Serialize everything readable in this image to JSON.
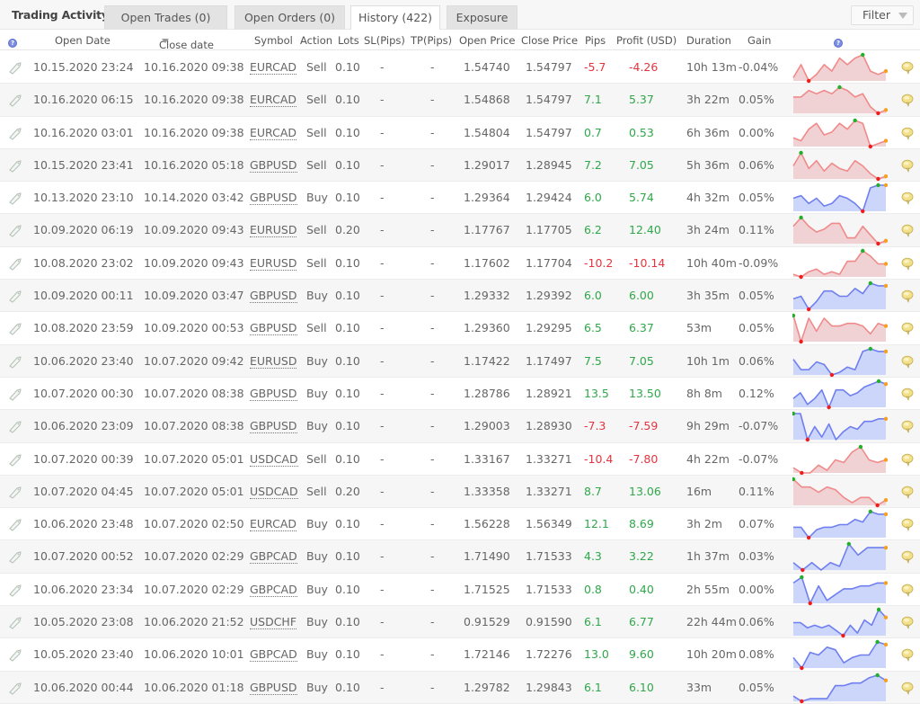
{
  "header": {
    "title": "Trading Activity",
    "tabs": [
      {
        "label": "Open Trades (0)",
        "active": false
      },
      {
        "label": "Open Orders (0)",
        "active": false
      },
      {
        "label": "History (422)",
        "active": true
      },
      {
        "label": "Exposure",
        "active": false
      }
    ],
    "filter_label": "Filter"
  },
  "columns": {
    "help_icon": "?",
    "open_date": "Open Date",
    "close_date": "Close date",
    "symbol": "Symbol",
    "action": "Action",
    "lots": "Lots",
    "sl": "SL(Pips)",
    "tp": "TP(Pips)",
    "open_price": "Open Price",
    "close_price": "Close Price",
    "pips": "Pips",
    "profit": "Profit (USD)",
    "duration": "Duration",
    "gain": "Gain",
    "chart_help": "?"
  },
  "colors": {
    "positive": "#2ea84a",
    "negative": "#e8333e",
    "sell_line": "#f08a8a",
    "sell_fill": "#f1d2d4",
    "buy_line": "#6f7ff0",
    "buy_fill": "#ccd6fb",
    "max_point": "#22b02a",
    "min_point": "#f01c1c",
    "last_point": "#f5a021"
  },
  "trades": [
    {
      "open_date": "10.15.2020 23:24",
      "close_date": "10.16.2020 09:38",
      "symbol": "EURCAD",
      "action": "Sell",
      "lots": "0.10",
      "sl": "-",
      "tp": "-",
      "open_price": "1.54740",
      "close_price": "1.54797",
      "pips": "-5.7",
      "profit": "-4.26",
      "duration": "10h 13m",
      "gain": "-0.04%",
      "spark": [
        3,
        7,
        2,
        4,
        7,
        5,
        9,
        7,
        9,
        10,
        5,
        4,
        5
      ]
    },
    {
      "open_date": "10.16.2020 06:15",
      "close_date": "10.16.2020 09:38",
      "symbol": "EURCAD",
      "action": "Sell",
      "lots": "0.10",
      "sl": "-",
      "tp": "-",
      "open_price": "1.54868",
      "close_price": "1.54797",
      "pips": "7.1",
      "profit": "5.37",
      "duration": "3h 22m",
      "gain": "0.05%",
      "spark": [
        7,
        7,
        9,
        8,
        9,
        8,
        10,
        9,
        7,
        8,
        4,
        2,
        3
      ]
    },
    {
      "open_date": "10.16.2020 03:01",
      "close_date": "10.16.2020 09:38",
      "symbol": "EURCAD",
      "action": "Sell",
      "lots": "0.10",
      "sl": "-",
      "tp": "-",
      "open_price": "1.54804",
      "close_price": "1.54797",
      "pips": "0.7",
      "profit": "0.53",
      "duration": "6h 36m",
      "gain": "0.00%",
      "spark": [
        3,
        2,
        6,
        8,
        4,
        5,
        8,
        6,
        9,
        8,
        0,
        1,
        2
      ]
    },
    {
      "open_date": "10.15.2020 23:41",
      "close_date": "10.16.2020 05:18",
      "symbol": "GBPUSD",
      "action": "Sell",
      "lots": "0.10",
      "sl": "-",
      "tp": "-",
      "open_price": "1.29017",
      "close_price": "1.28945",
      "pips": "7.2",
      "profit": "7.05",
      "duration": "5h 36m",
      "gain": "0.06%",
      "spark": [
        5,
        10,
        4,
        7,
        3,
        6,
        4,
        3,
        7,
        5,
        2,
        0,
        1
      ]
    },
    {
      "open_date": "10.13.2020 23:10",
      "close_date": "10.14.2020 03:42",
      "symbol": "GBPUSD",
      "action": "Buy",
      "lots": "0.10",
      "sl": "-",
      "tp": "-",
      "open_price": "1.29364",
      "close_price": "1.29424",
      "pips": "6.0",
      "profit": "5.74",
      "duration": "4h 32m",
      "gain": "0.05%",
      "spark": [
        5,
        6,
        3,
        5,
        2,
        3,
        6,
        5,
        3,
        0,
        9,
        10,
        10
      ]
    },
    {
      "open_date": "10.09.2020 06:19",
      "close_date": "10.09.2020 09:43",
      "symbol": "EURUSD",
      "action": "Sell",
      "lots": "0.20",
      "sl": "-",
      "tp": "-",
      "open_price": "1.17767",
      "close_price": "1.17705",
      "pips": "6.2",
      "profit": "12.40",
      "duration": "3h 24m",
      "gain": "0.11%",
      "spark": [
        6,
        9,
        6,
        4,
        5,
        7,
        7,
        2,
        2,
        6,
        3,
        0,
        1
      ]
    },
    {
      "open_date": "10.08.2020 23:02",
      "close_date": "10.09.2020 09:43",
      "symbol": "EURUSD",
      "action": "Sell",
      "lots": "0.10",
      "sl": "-",
      "tp": "-",
      "open_price": "1.17602",
      "close_price": "1.17704",
      "pips": "-10.2",
      "profit": "-10.14",
      "duration": "10h 40m",
      "gain": "-0.09%",
      "spark": [
        1,
        0,
        2,
        3,
        1,
        2,
        1,
        6,
        6,
        10,
        8,
        5,
        5
      ]
    },
    {
      "open_date": "10.09.2020 00:11",
      "close_date": "10.09.2020 03:47",
      "symbol": "GBPUSD",
      "action": "Buy",
      "lots": "0.10",
      "sl": "-",
      "tp": "-",
      "open_price": "1.29332",
      "close_price": "1.29392",
      "pips": "6.0",
      "profit": "6.00",
      "duration": "3h 35m",
      "gain": "0.05%",
      "spark": [
        4,
        5,
        0,
        3,
        7,
        7,
        5,
        5,
        8,
        6,
        10,
        9,
        9
      ]
    },
    {
      "open_date": "10.08.2020 23:59",
      "close_date": "10.09.2020 00:53",
      "symbol": "GBPUSD",
      "action": "Sell",
      "lots": "0.10",
      "sl": "-",
      "tp": "-",
      "open_price": "1.29360",
      "close_price": "1.29295",
      "pips": "6.5",
      "profit": "6.37",
      "duration": "53m",
      "gain": "0.05%",
      "spark": [
        10,
        0,
        9,
        4,
        9,
        6,
        6,
        7,
        7,
        6,
        3,
        7,
        6
      ]
    },
    {
      "open_date": "10.06.2020 23:40",
      "close_date": "10.07.2020 09:42",
      "symbol": "EURUSD",
      "action": "Buy",
      "lots": "0.10",
      "sl": "-",
      "tp": "-",
      "open_price": "1.17422",
      "close_price": "1.17497",
      "pips": "7.5",
      "profit": "7.05",
      "duration": "10h 1m",
      "gain": "0.06%",
      "spark": [
        6,
        2,
        2,
        5,
        4,
        0,
        1,
        3,
        2,
        9,
        10,
        9,
        9
      ]
    },
    {
      "open_date": "10.07.2020 00:30",
      "close_date": "10.07.2020 08:38",
      "symbol": "GBPUSD",
      "action": "Buy",
      "lots": "0.10",
      "sl": "-",
      "tp": "-",
      "open_price": "1.28786",
      "close_price": "1.28921",
      "pips": "13.5",
      "profit": "13.50",
      "duration": "8h 8m",
      "gain": "0.12%",
      "spark": [
        3,
        5,
        1,
        3,
        6,
        0,
        6,
        6,
        4,
        5,
        7,
        8,
        9,
        8
      ]
    },
    {
      "open_date": "10.06.2020 23:09",
      "close_date": "10.07.2020 08:38",
      "symbol": "GBPUSD",
      "action": "Buy",
      "lots": "0.10",
      "sl": "-",
      "tp": "-",
      "open_price": "1.29003",
      "close_price": "1.28930",
      "pips": "-7.3",
      "profit": "-7.59",
      "duration": "9h 29m",
      "gain": "-0.07%",
      "spark": [
        10,
        10,
        0,
        5,
        1,
        6,
        0,
        3,
        5,
        4,
        7,
        7,
        8,
        8
      ]
    },
    {
      "open_date": "10.07.2020 00:39",
      "close_date": "10.07.2020 05:01",
      "symbol": "USDCAD",
      "action": "Sell",
      "lots": "0.10",
      "sl": "-",
      "tp": "-",
      "open_price": "1.33167",
      "close_price": "1.33271",
      "pips": "-10.4",
      "profit": "-7.80",
      "duration": "4h 22m",
      "gain": "-0.07%",
      "spark": [
        2,
        0,
        0,
        3,
        1,
        5,
        4,
        8,
        10,
        5,
        4,
        5
      ]
    },
    {
      "open_date": "10.07.2020 04:45",
      "close_date": "10.07.2020 05:01",
      "symbol": "USDCAD",
      "action": "Sell",
      "lots": "0.20",
      "sl": "-",
      "tp": "-",
      "open_price": "1.33358",
      "close_price": "1.33271",
      "pips": "8.7",
      "profit": "13.06",
      "duration": "16m",
      "gain": "0.11%",
      "spark": [
        10,
        7,
        7,
        5,
        7,
        6,
        3,
        1,
        3,
        3,
        0,
        2
      ]
    },
    {
      "open_date": "10.06.2020 23:48",
      "close_date": "10.07.2020 02:50",
      "symbol": "EURCAD",
      "action": "Buy",
      "lots": "0.10",
      "sl": "-",
      "tp": "-",
      "open_price": "1.56228",
      "close_price": "1.56349",
      "pips": "12.1",
      "profit": "8.69",
      "duration": "3h 2m",
      "gain": "0.07%",
      "spark": [
        4,
        4,
        0,
        3,
        4,
        4,
        5,
        5,
        7,
        6,
        10,
        9,
        9
      ]
    },
    {
      "open_date": "10.07.2020 00:52",
      "close_date": "10.07.2020 02:29",
      "symbol": "GBPCAD",
      "action": "Buy",
      "lots": "0.10",
      "sl": "-",
      "tp": "-",
      "open_price": "1.71490",
      "close_price": "1.71533",
      "pips": "4.3",
      "profit": "3.22",
      "duration": "1h 37m",
      "gain": "0.03%",
      "spark": [
        5,
        3,
        5,
        3,
        5,
        4,
        10,
        7,
        9,
        9,
        9
      ]
    },
    {
      "open_date": "10.06.2020 23:34",
      "close_date": "10.07.2020 02:29",
      "symbol": "GBPCAD",
      "action": "Buy",
      "lots": "0.10",
      "sl": "-",
      "tp": "-",
      "open_price": "1.71525",
      "close_price": "1.71533",
      "pips": "0.8",
      "profit": "0.40",
      "duration": "2h 55m",
      "gain": "0.00%",
      "spark": [
        7,
        9,
        0,
        6,
        1,
        3,
        5,
        5,
        6,
        6,
        7,
        7
      ]
    },
    {
      "open_date": "10.05.2020 23:08",
      "close_date": "10.06.2020 21:52",
      "symbol": "USDCHF",
      "action": "Buy",
      "lots": "0.10",
      "sl": "-",
      "tp": "-",
      "open_price": "0.91529",
      "close_price": "0.91590",
      "pips": "6.1",
      "profit": "6.77",
      "duration": "22h 44m",
      "gain": "0.06%",
      "spark": [
        5,
        5,
        3,
        4,
        3,
        4,
        2,
        0,
        4,
        1,
        6,
        4,
        10,
        7
      ]
    },
    {
      "open_date": "10.05.2020 23:40",
      "close_date": "10.06.2020 10:01",
      "symbol": "GBPCAD",
      "action": "Buy",
      "lots": "0.10",
      "sl": "-",
      "tp": "-",
      "open_price": "1.72146",
      "close_price": "1.72276",
      "pips": "13.0",
      "profit": "9.60",
      "duration": "10h 20m",
      "gain": "0.08%",
      "spark": [
        4,
        0,
        6,
        5,
        8,
        7,
        2,
        4,
        5,
        5,
        10,
        9
      ]
    },
    {
      "open_date": "10.06.2020 00:44",
      "close_date": "10.06.2020 01:18",
      "symbol": "GBPUSD",
      "action": "Buy",
      "lots": "0.10",
      "sl": "-",
      "tp": "-",
      "open_price": "1.29782",
      "close_price": "1.29843",
      "pips": "6.1",
      "profit": "6.10",
      "duration": "33m",
      "gain": "0.05%",
      "spark": [
        2,
        0,
        1,
        1,
        1,
        6,
        6,
        7,
        7,
        9,
        10,
        8
      ]
    }
  ]
}
